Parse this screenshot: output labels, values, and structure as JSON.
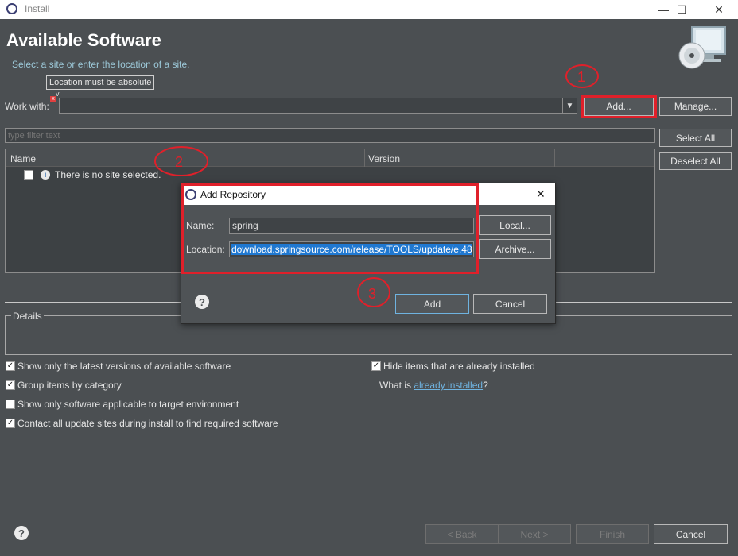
{
  "window": {
    "title": "Install",
    "controls": {
      "minimize": "—",
      "maximize": "☐",
      "close": "✕"
    }
  },
  "header": {
    "title": "Available Software",
    "subtitle": "Select a site or enter the location of a site."
  },
  "tooltip": "Location must be absolute",
  "work_with": {
    "label": "Work with:",
    "value": "",
    "add_label": "Add...",
    "manage_label": "Manage..."
  },
  "filter": {
    "placeholder": "type filter text"
  },
  "table": {
    "columns": [
      "Name",
      "Version"
    ],
    "empty_message": "There is no site selected."
  },
  "side_buttons": {
    "select_all": "Select All",
    "deselect_all": "Deselect All"
  },
  "details": {
    "label": "Details"
  },
  "options": [
    {
      "label": "Show only the latest versions of available software",
      "checked": true
    },
    {
      "label": "Group items by category",
      "checked": true
    },
    {
      "label": "Show only software applicable to target environment",
      "checked": false
    },
    {
      "label": "Contact all update sites during install to find required software",
      "checked": true
    }
  ],
  "options_right": {
    "hide_installed": {
      "label": "Hide items that are already installed",
      "checked": true
    },
    "what_is_prefix": "What is ",
    "what_is_link": "already installed",
    "what_is_suffix": "?"
  },
  "footer": {
    "back": "< Back",
    "next": "Next >",
    "finish": "Finish",
    "cancel": "Cancel"
  },
  "dialog": {
    "title": "Add Repository",
    "name_label": "Name:",
    "name_value": "spring",
    "location_label": "Location:",
    "location_value": "download.springsource.com/release/TOOLS/update/e.48",
    "local_button": "Local...",
    "archive_button": "Archive...",
    "add_button": "Add",
    "cancel_button": "Cancel",
    "close": "✕"
  },
  "annotations": {
    "mark1": "1",
    "mark2": "2",
    "mark3": "3"
  },
  "colors": {
    "background": "#4b4f52",
    "highlight_red": "#e0202a",
    "link": "#6fb3e0",
    "selection": "#1f78d1"
  }
}
